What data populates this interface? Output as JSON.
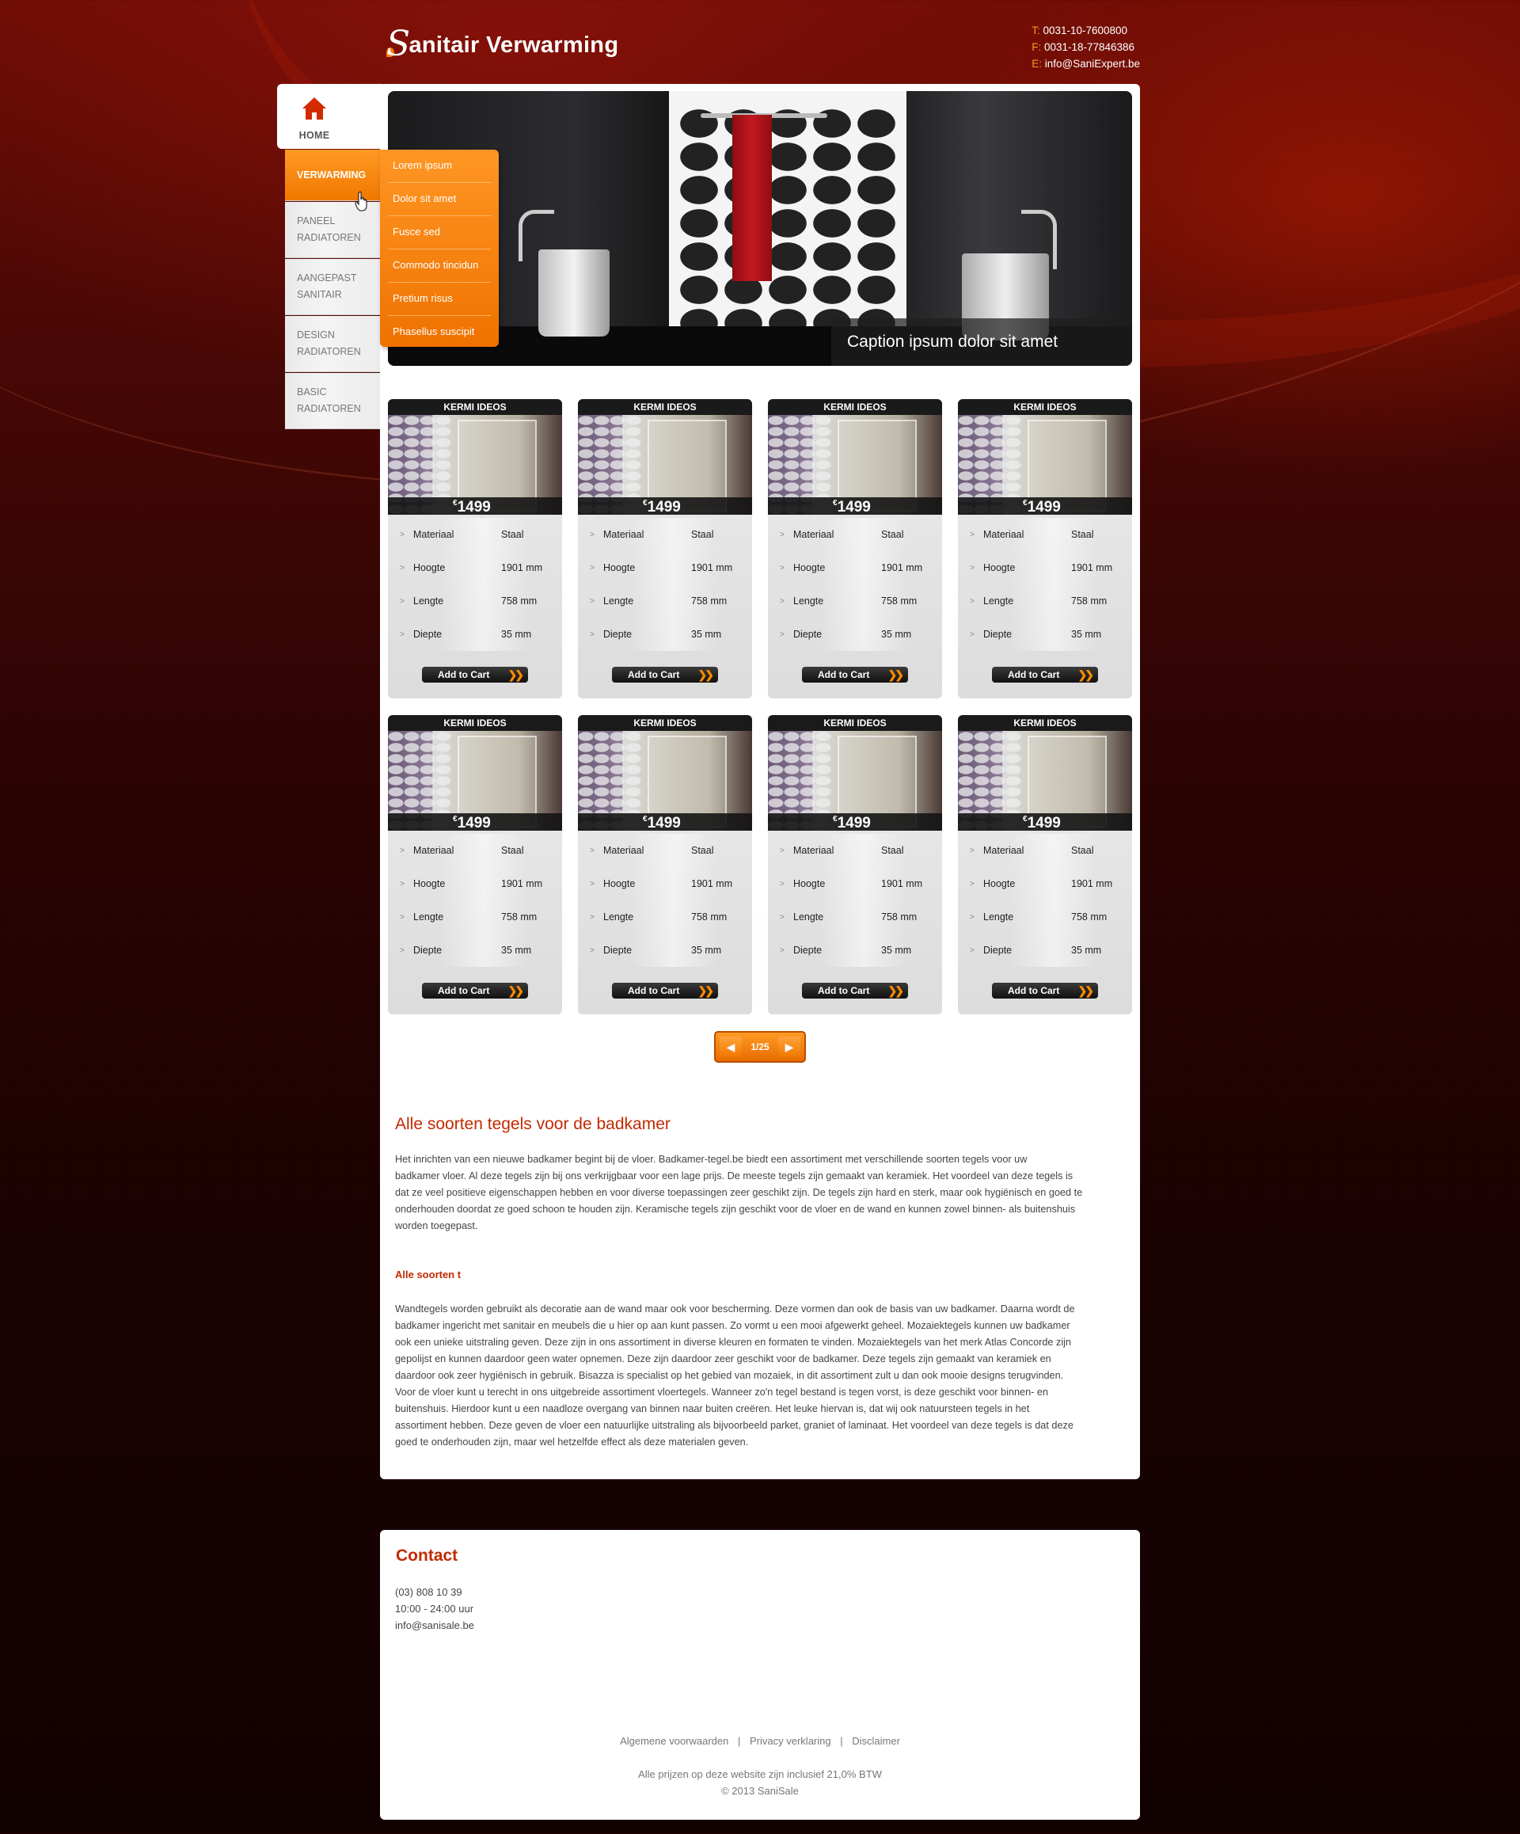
{
  "header": {
    "logo_initial": "S",
    "logo_text": "anitair Verwarming",
    "phone_label": "T:",
    "phone": "0031-10-7600800",
    "fax_label": "F:",
    "fax": "0031-18-77846386",
    "email_label": "E:",
    "email": "info@SaniExpert.be"
  },
  "nav": {
    "home_label": "HOME",
    "items": [
      {
        "label": "VERWARMING"
      },
      {
        "label": "PANEEL RADIATOREN"
      },
      {
        "label": "AANGEPAST SANITAIR"
      },
      {
        "label": "DESIGN RADIATOREN"
      },
      {
        "label": "BASIC RADIATOREN"
      }
    ],
    "submenu": [
      "Lorem ipsum",
      "Dolor sit amet",
      "Fusce sed",
      "Commodo tincidun",
      "Pretium risus",
      "Phasellus suscipit"
    ]
  },
  "slider": {
    "caption": "Caption ipsum dolor sit amet"
  },
  "product": {
    "title": "KERMI IDEOS",
    "currency": "€",
    "price": "1499",
    "specs": [
      {
        "k": "Materiaal",
        "v": "Staal"
      },
      {
        "k": "Hoogte",
        "v": "1901 mm"
      },
      {
        "k": "Lengte",
        "v": "758 mm"
      },
      {
        "k": "Diepte",
        "v": "35 mm"
      }
    ],
    "cart_label": "Add to Cart",
    "count": 8
  },
  "pager": {
    "current": "1/25"
  },
  "article": {
    "title": "Alle soorten tegels voor de badkamer",
    "p1_lines": [
      "Het inrichten van een nieuwe badkamer begint bij de vloer. Badkamer-tegel.be biedt een assortiment met verschillende soorten tegels voor uw",
      "badkamer vloer. Al deze tegels zijn bij ons verkrijgbaar voor een lage prijs. De meeste tegels zijn gemaakt van keramiek. Het voordeel van deze tegels is",
      "dat ze veel positieve eigenschappen hebben en voor diverse toepassingen zeer geschikt zijn. De tegels zijn hard en sterk, maar ook hygiënisch en goed te",
      "onderhouden doordat ze goed schoon te houden zijn. Keramische tegels zijn geschikt voor de vloer en de wand en kunnen zowel binnen- als buitenshuis",
      "worden toegepast."
    ],
    "subtitle": "Alle soorten t",
    "p2_lines": [
      "Wandtegels worden gebruikt als decoratie aan de wand maar ook voor bescherming. Deze vormen dan ook de basis van uw badkamer. Daarna wordt de",
      "badkamer ingericht met sanitair en meubels die u hier op aan kunt passen. Zo vormt u een mooi afgewerkt geheel. Mozaiektegels kunnen uw badkamer",
      "ook een unieke uitstraling geven. Deze zijn in ons assortiment in diverse kleuren en formaten te vinden. Mozaiektegels van het merk Atlas Concorde zijn",
      "gepolijst en kunnen daardoor geen water opnemen. Deze zijn daardoor zeer geschikt voor de badkamer. Deze tegels zijn gemaakt van keramiek en",
      "daardoor ook zeer hygiënisch in gebruik. Bisazza is specialist op het gebied van mozaiek, in dit assortiment zult u dan ook mooie designs terugvinden.",
      "Voor de vloer kunt u terecht in ons uitgebreide assortiment vloertegels. Wanneer zo'n tegel bestand is tegen vorst, is deze geschikt voor binnen- en",
      "buitenshuis. Hierdoor kunt u een naadloze overgang van binnen naar buiten creëren. Het leuke hiervan is, dat wij ook natuursteen tegels in het",
      "assortiment hebben. Deze geven de vloer een natuurlijke uitstraling als bijvoorbeeld parket, graniet of laminaat. Het voordeel van deze tegels is dat deze",
      "goed te onderhouden zijn, maar wel hetzelfde effect als deze materialen geven."
    ]
  },
  "contact": {
    "title": "Contact",
    "phone": "(03) 808 10 39",
    "hours": "10:00 - 24:00 uur",
    "email": "info@sanisale.be"
  },
  "footer": {
    "links": [
      "Algemene voorwaarden",
      "Privacy verklaring",
      "Disclaimer"
    ],
    "separator": "|",
    "vat_note": "Alle prijzen op deze website zijn inclusief 21,0% BTW",
    "copyright": "© 2013 SaniSale"
  },
  "colors": {
    "accent": "#ff8a1a",
    "heading": "#c22a00",
    "background": "#2a0403"
  },
  "icons": {
    "home": "house-icon",
    "cursor": "hand-cursor-icon",
    "prev": "triangle-left-icon",
    "next": "triangle-right-icon",
    "cart": "double-chevron-icon"
  }
}
